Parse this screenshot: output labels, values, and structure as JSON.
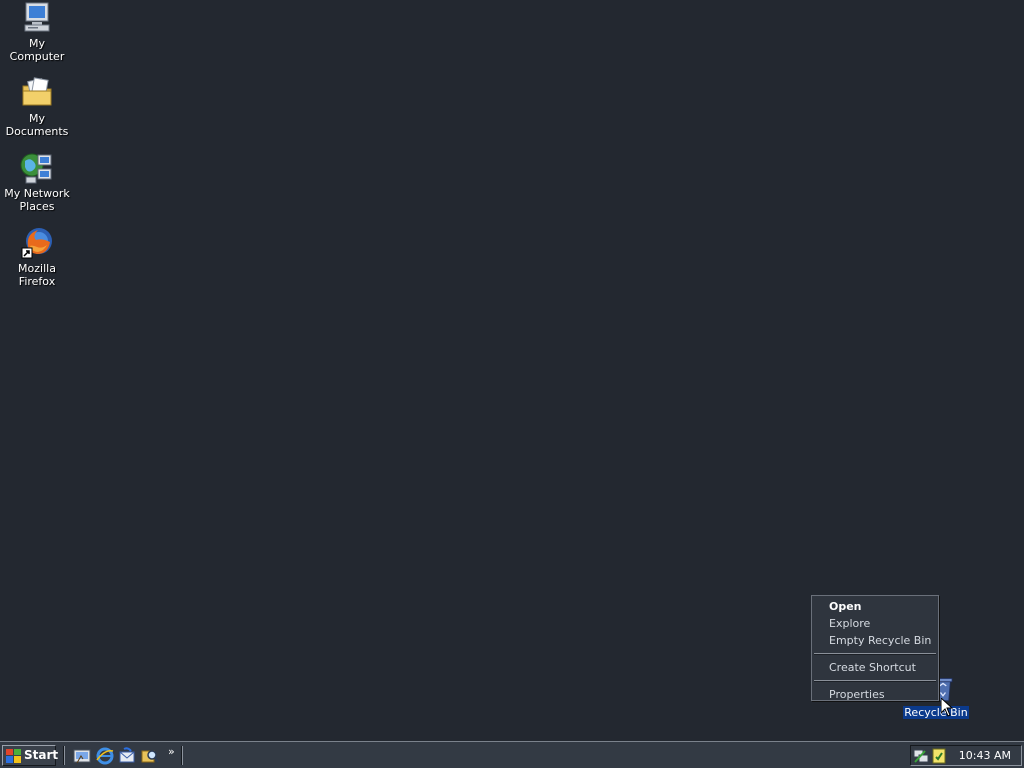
{
  "desktop": {
    "icons": [
      {
        "label": "My Computer",
        "icon": "my-computer-icon"
      },
      {
        "label": "My Documents",
        "icon": "my-documents-icon"
      },
      {
        "label": "My Network Places",
        "icon": "network-places-icon"
      },
      {
        "label": "Mozilla Firefox",
        "icon": "firefox-icon"
      },
      {
        "label": "Recycle Bin",
        "icon": "recycle-bin-icon"
      }
    ]
  },
  "context_menu": {
    "items": [
      {
        "label": "Open",
        "default": true
      },
      {
        "label": "Explore"
      },
      {
        "label": "Empty Recycle Bin"
      },
      {
        "label": "Create Shortcut"
      },
      {
        "label": "Properties"
      }
    ]
  },
  "taskbar": {
    "start_label": "Start",
    "quick_launch": [
      {
        "icon": "show-desktop-icon"
      },
      {
        "icon": "internet-explorer-icon"
      },
      {
        "icon": "outlook-express-icon"
      },
      {
        "icon": "search-icon"
      }
    ],
    "chevron": "»",
    "tray_icons": [
      {
        "icon": "network-connection-icon"
      },
      {
        "icon": "antivirus-icon"
      }
    ],
    "clock": "10:43 AM"
  },
  "colors": {
    "desktop_bg": "#232830",
    "taskbar_bg": "#333a44",
    "selection": "#0b3a8c"
  }
}
